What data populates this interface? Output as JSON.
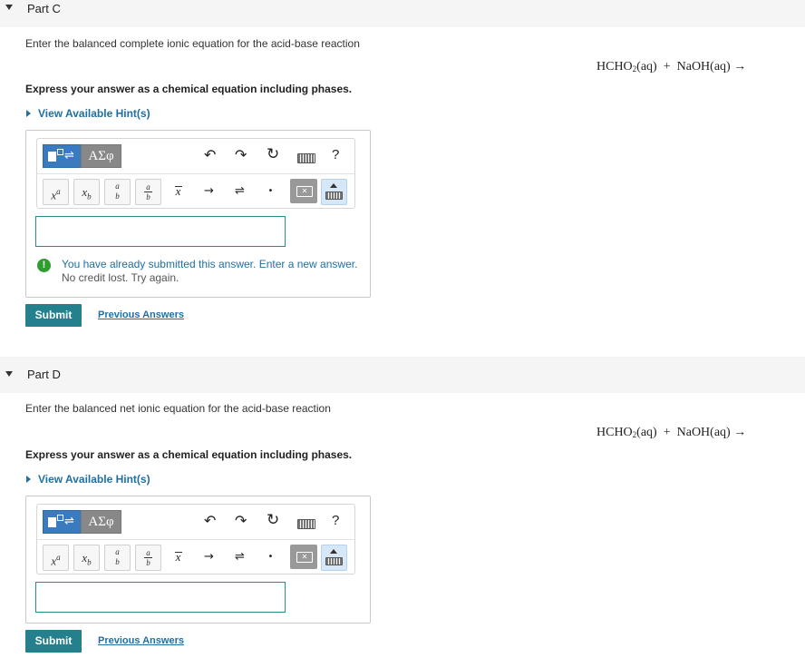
{
  "parts": [
    {
      "title": "Part C",
      "prompt": "Enter the balanced complete ionic equation for the acid-base reaction",
      "equation": {
        "lhs_a": "HCHO",
        "lhs_a_sub": "2",
        "lhs_a_phase": "(aq)",
        "plus": "+",
        "lhs_b": "NaOH(aq)",
        "arrow": "→"
      },
      "instruction": "Express your answer as a chemical equation including phases.",
      "hint_label": "View Available Hint(s)",
      "toolbar": {
        "greek_label": "ΑΣφ",
        "help_label": "?",
        "x_sup_base": "x",
        "x_sup_exp": "a",
        "x_sub_base": "x",
        "x_sub_sub": "b",
        "frac_top": "a",
        "frac_bottom": "b",
        "xbar": "x",
        "arrow_symbol": "→",
        "equilibrium_symbol": "⇌",
        "dot_symbol": "•"
      },
      "answer_value": "",
      "warning_line1": "You have already submitted this answer. Enter a new answer.",
      "warning_line2": "No credit lost. Try again.",
      "submit_label": "Submit",
      "previous_label": "Previous Answers"
    },
    {
      "title": "Part D",
      "prompt": "Enter the balanced net ionic equation for the acid-base reaction",
      "equation": {
        "lhs_a": "HCHO",
        "lhs_a_sub": "2",
        "lhs_a_phase": "(aq)",
        "plus": "+",
        "lhs_b": "NaOH(aq)",
        "arrow": "→"
      },
      "instruction": "Express your answer as a chemical equation including phases.",
      "hint_label": "View Available Hint(s)",
      "toolbar": {
        "greek_label": "ΑΣφ",
        "help_label": "?",
        "x_sup_base": "x",
        "x_sup_exp": "a",
        "x_sub_base": "x",
        "x_sub_sub": "b",
        "frac_top": "a",
        "frac_bottom": "b",
        "xbar": "x",
        "arrow_symbol": "→",
        "equilibrium_symbol": "⇌",
        "dot_symbol": "•"
      },
      "answer_value": "",
      "submit_label": "Submit",
      "previous_label": "Previous Answers"
    }
  ],
  "icons": [
    "collapse-caret-icon",
    "template-icon",
    "undo-icon",
    "redo-icon",
    "reset-icon",
    "keyboard-icon",
    "help-icon",
    "backspace-icon",
    "keyboard-toggle-icon",
    "warning-icon"
  ],
  "colors": {
    "accent": "#24808c",
    "link": "#1f6fa3",
    "warning": "#2e9e2e",
    "template_button": "#3a7bbf"
  }
}
